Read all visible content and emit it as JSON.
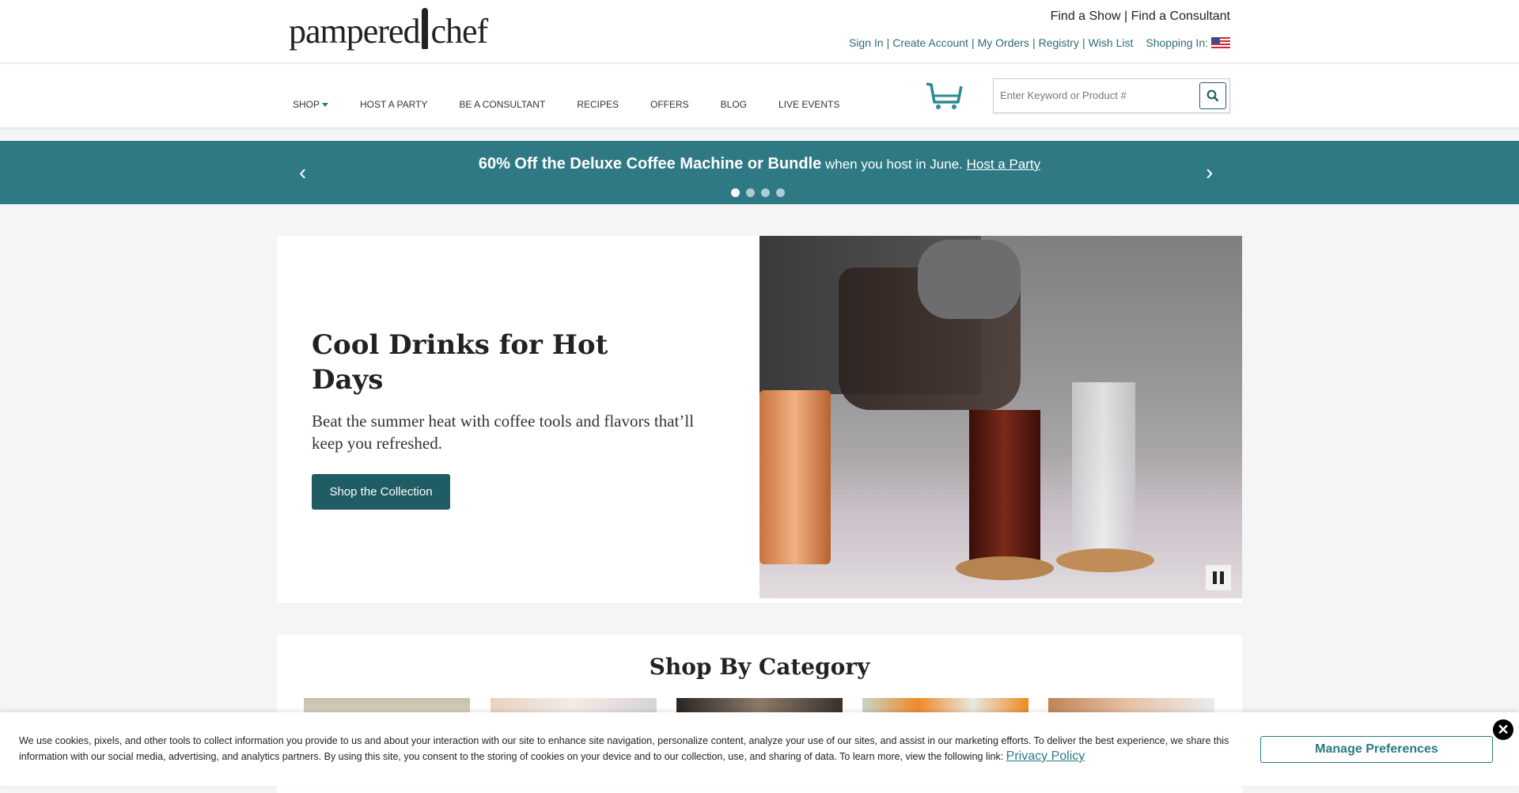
{
  "brand": {
    "logo_left": "pampered",
    "logo_right": "chef"
  },
  "header": {
    "find_show": "Find a Show",
    "find_consultant": "Find a Consultant",
    "sep": "|",
    "account_links": [
      "Sign In",
      "Create Account",
      "My Orders",
      "Registry",
      "Wish List"
    ],
    "shopping_in": "Shopping In:",
    "flag_icon": "us-flag-icon"
  },
  "nav": {
    "items": [
      "SHOP",
      "HOST A PARTY",
      "BE A CONSULTANT",
      "RECIPES",
      "OFFERS",
      "BLOG",
      "LIVE EVENTS"
    ]
  },
  "search": {
    "placeholder": "Enter Keyword or Product #",
    "value": ""
  },
  "promo": {
    "bold": "60% Off the Deluxe Coffee Machine or Bundle",
    "text": " when you host in June. ",
    "link": "Host a Party",
    "slides": 4,
    "active_slide": 1,
    "color": "#2e7984"
  },
  "hero": {
    "title": "Cool Drinks for Hot Days",
    "subtitle": "Beat the summer heat with coffee tools and flavors that’ll keep you refreshed.",
    "button": "Shop the Collection"
  },
  "category": {
    "title": "Shop By Category"
  },
  "cookie": {
    "text": "We use cookies, pixels, and other tools to collect information you provide to us and about your interaction with our site to enhance site navigation, personalize content, analyze your use of our sites, and assist in our marketing efforts. To deliver the best experience, we share this information with our social media, advertising, and analytics partners. By using this site, you consent to the storing of cookies on your device and to our collection, use, and sharing of data. To learn more, view the following link: ",
    "link": "Privacy Policy",
    "button": "Manage Preferences",
    "close": "✕"
  }
}
